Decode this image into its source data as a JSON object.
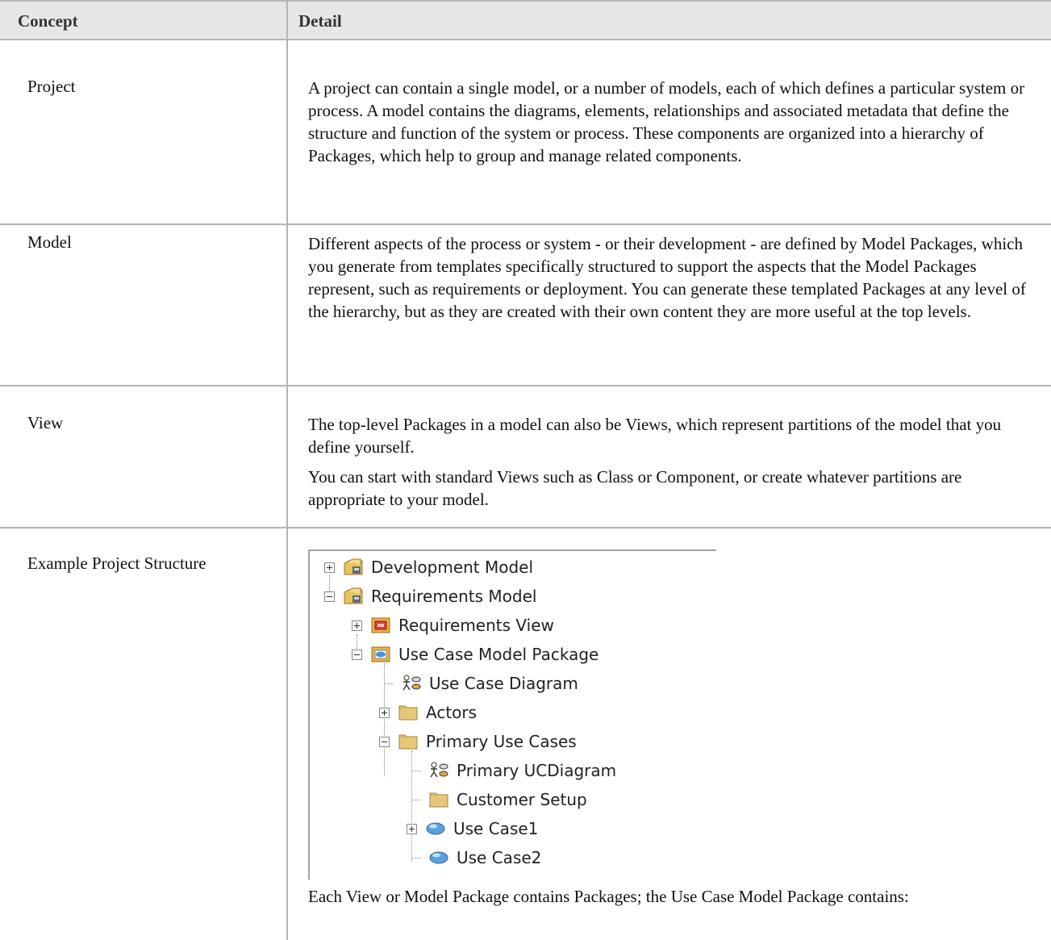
{
  "table": {
    "headers": {
      "concept": "Concept",
      "detail": "Detail"
    },
    "rows": [
      {
        "concept": "Project",
        "detail": [
          "A project can contain a single model, or a number of models, each of which defines a particular system or process. A model contains the diagrams, elements, relationships and associated metadata that define the structure and function of the system or process. These components are organized into a hierarchy of Packages, which help to group and manage related components."
        ]
      },
      {
        "concept": "Model",
        "detail": [
          "Different aspects of the process or system - or their development - are defined by Model Packages, which you generate from templates specifically structured to support the aspects that the Model Packages represent, such as requirements or deployment. You can generate these templated Packages at any level of the hierarchy, but as they are created with their own content they are more useful at the top levels."
        ]
      },
      {
        "concept": "View",
        "detail": [
          "The top-level Packages in a model can also be Views, which represent partitions of the model that you define yourself.",
          "You can start with standard Views such as Class or Component, or create whatever partitions are appropriate to your model."
        ]
      },
      {
        "concept": "Example Project Structure",
        "tree": [
          {
            "label": "Development Model",
            "icon": "model-package-icon",
            "expander": "plus"
          },
          {
            "label": "Requirements Model",
            "icon": "model-package-icon",
            "expander": "minus"
          },
          {
            "label": "Requirements View",
            "icon": "requirements-view-icon",
            "expander": "plus"
          },
          {
            "label": "Use Case Model Package",
            "icon": "use-case-view-icon",
            "expander": "minus"
          },
          {
            "label": "Use Case Diagram",
            "icon": "use-case-diagram-icon",
            "expander": "none"
          },
          {
            "label": "Actors",
            "icon": "folder-icon",
            "expander": "plus"
          },
          {
            "label": "Primary Use Cases",
            "icon": "folder-icon",
            "expander": "minus"
          },
          {
            "label": "Primary UCDiagram",
            "icon": "use-case-diagram-icon",
            "expander": "none"
          },
          {
            "label": "Customer Setup",
            "icon": "folder-icon",
            "expander": "none"
          },
          {
            "label": "Use Case1",
            "icon": "use-case-icon",
            "expander": "plus"
          },
          {
            "label": "Use Case2",
            "icon": "use-case-icon",
            "expander": "none"
          }
        ],
        "caption": "Each View or Model Package contains Packages; the Use Case Model Package contains:"
      }
    ]
  }
}
